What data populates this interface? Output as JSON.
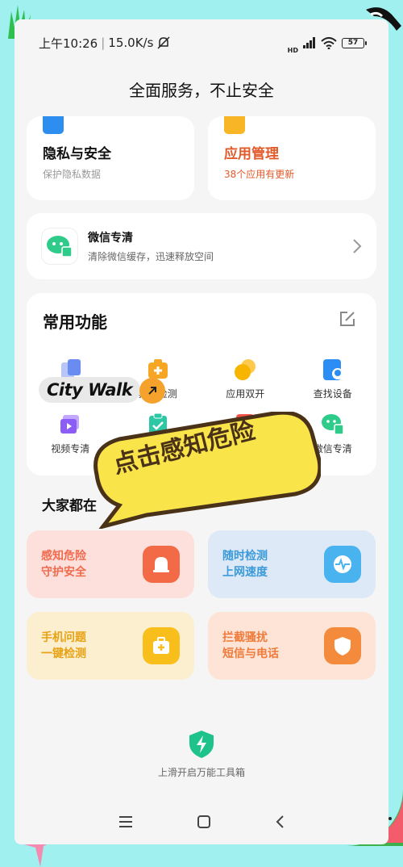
{
  "status_bar": {
    "time": "上午10:26",
    "net_speed": "15.0K/s",
    "net_type": "HD",
    "battery": "57",
    "icons": [
      "mute-bell-icon",
      "signal-icon",
      "wifi-icon",
      "battery-icon"
    ]
  },
  "page_title": "全面服务，不止安全",
  "top_cards": [
    {
      "title": "隐私与安全",
      "subtitle": "保护隐私数据",
      "icon": "privacy-icon",
      "icon_color": "#2d8ef0",
      "subtitle_color": "#999999"
    },
    {
      "title": "应用管理",
      "subtitle": "38个应用有更新",
      "icon": "app-manage-icon",
      "icon_color": "#f8b626",
      "subtitle_color": "#e05a2a",
      "title_color": "#e05a2a"
    }
  ],
  "wechat_card": {
    "title": "微信专清",
    "subtitle": "清除微信缓存，迅速释放空间"
  },
  "functions": {
    "title": "常用功能",
    "items": [
      {
        "label": "",
        "icon": "app-stack-icon",
        "color": "#6a8cf0"
      },
      {
        "label": "异常检测",
        "icon": "med-kit-icon",
        "color": "#f6a623"
      },
      {
        "label": "应用双开",
        "icon": "dual-app-icon",
        "color": "#f7b500"
      },
      {
        "label": "查找设备",
        "icon": "find-device-icon",
        "color": "#2c8ef5"
      },
      {
        "label": "视频专清",
        "icon": "video-clean-icon",
        "color": "#8b5cf6"
      },
      {
        "label": "",
        "icon": "clipboard-check-icon",
        "color": "#2dc7a6"
      },
      {
        "label": "",
        "icon": "red-app-icon",
        "color": "#f2544a"
      },
      {
        "label": "微信专清",
        "icon": "wechat-clean-icon",
        "color": "#2fcb8a"
      }
    ]
  },
  "section_title": "大家都在",
  "promos": [
    {
      "line1": "感知危险",
      "line2": "守护安全",
      "icon": "alarm-icon",
      "bg": "#fde0dc",
      "fg": "#f06b4e",
      "icon_bg": "#f26a46"
    },
    {
      "line1": "随时检测",
      "line2": "上网速度",
      "icon": "speed-monitor-icon",
      "bg": "#dde9f7",
      "fg": "#3b9ad9",
      "icon_bg": "#49b3ef"
    },
    {
      "line1": "手机问题",
      "line2": "一键检测",
      "icon": "repair-kit-icon",
      "bg": "#fbefcf",
      "fg": "#e8a213",
      "icon_bg": "#f8be1b"
    },
    {
      "line1": "拦截骚扰",
      "line2": "短信与电话",
      "icon": "shield-icon",
      "bg": "#fde4d6",
      "fg": "#ef7a3a",
      "icon_bg": "#f48a3b"
    }
  ],
  "swipe_hint": "上滑开启万能工具箱",
  "nav": [
    "menu-icon",
    "home-icon",
    "back-icon"
  ],
  "overlay": {
    "tag": "City Walk",
    "bubble": "点击感知危险"
  }
}
